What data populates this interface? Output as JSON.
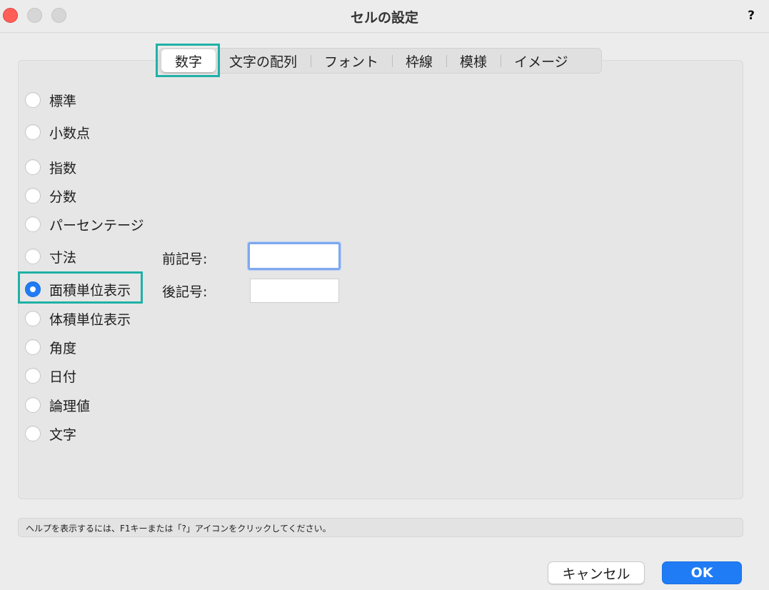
{
  "window": {
    "title": "セルの設定",
    "help_glyph": "?"
  },
  "tabs": [
    "数字",
    "文字の配列",
    "フォント",
    "枠線",
    "模様",
    "イメージ"
  ],
  "active_tab": "数字",
  "options": [
    {
      "label": "標準",
      "selected": false
    },
    {
      "label": "小数点",
      "selected": false
    },
    {
      "label": "指数",
      "selected": false
    },
    {
      "label": "分数",
      "selected": false
    },
    {
      "label": "パーセンテージ",
      "selected": false
    },
    {
      "label": "寸法",
      "selected": false
    },
    {
      "label": "面積単位表示",
      "selected": true
    },
    {
      "label": "体積単位表示",
      "selected": false
    },
    {
      "label": "角度",
      "selected": false
    },
    {
      "label": "日付",
      "selected": false
    },
    {
      "label": "論理値",
      "selected": false
    },
    {
      "label": "文字",
      "selected": false
    }
  ],
  "fields": {
    "prefix_label": "前記号:",
    "prefix_value": "",
    "suffix_label": "後記号:",
    "suffix_value": ""
  },
  "status": {
    "help_text": "ヘルプを表示するには、F1キーまたは「?」アイコンをクリックしてください。"
  },
  "buttons": {
    "cancel": "キャンセル",
    "ok": "OK"
  },
  "colors": {
    "accent": "#1f7cf5",
    "highlight": "#1fb1a6",
    "close": "#ff5f57"
  }
}
